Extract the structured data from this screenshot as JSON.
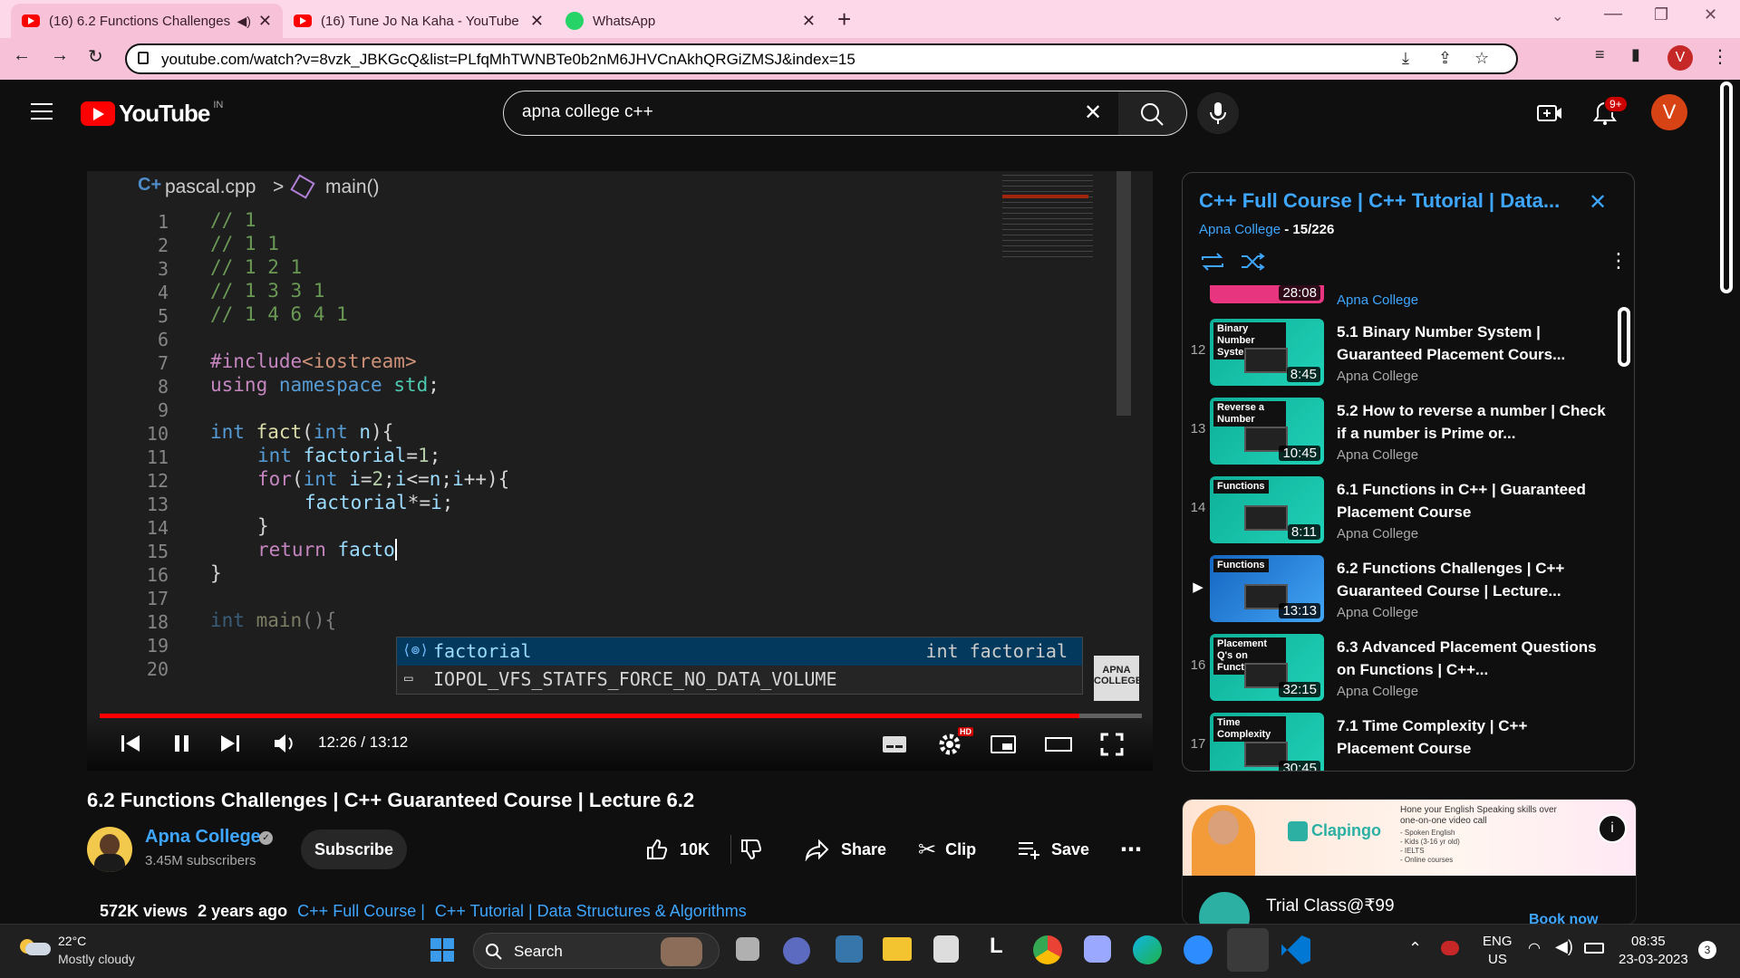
{
  "browser": {
    "tabs": [
      {
        "title": "(16) 6.2 Functions Challenges",
        "icon": "youtube-icon",
        "active": true
      },
      {
        "title": "(16) Tune Jo Na Kaha - YouTube",
        "icon": "youtube-icon",
        "active": false
      },
      {
        "title": "WhatsApp",
        "icon": "whatsapp-icon",
        "active": false
      }
    ],
    "url": "youtube.com/watch?v=8vzk_JBKGcQ&list=PLfqMhTWNBTe0b2nM6JHVCnAkhQRGiZMSJ&index=15",
    "profile_initial": "V"
  },
  "youtube": {
    "logo_text": "YouTube",
    "region": "IN",
    "search_value": "apna college c++",
    "notifications_badge": "9+",
    "avatar_initial": "V"
  },
  "editor": {
    "breadcrumb_file": "pascal.cpp",
    "breadcrumb_symbol": "main()",
    "line_numbers": [
      "1",
      "2",
      "3",
      "4",
      "5",
      "6",
      "7",
      "8",
      "9",
      "10",
      "11",
      "12",
      "13",
      "14",
      "15",
      "16",
      "17",
      "18",
      "19",
      "20"
    ],
    "suggestions": [
      {
        "text": "factorial",
        "detail": "int factorial"
      },
      {
        "text": "IOPOL_VFS_STATFS_FORCE_NO_DATA_VOLUME",
        "detail": ""
      }
    ],
    "watermark": "APNA COLLEGE"
  },
  "player": {
    "time_current": "12:26",
    "time_total": "13:12",
    "time_display": "12:26 / 13:12",
    "progress_fraction": 0.94,
    "hd_badge": "HD"
  },
  "video": {
    "title": "6.2 Functions Challenges | C++ Guaranteed Course | Lecture 6.2",
    "channel": "Apna College",
    "subscribers": "3.45M subscribers",
    "subscribe_label": "Subscribe",
    "likes": "10K",
    "share_label": "Share",
    "clip_label": "Clip",
    "save_label": "Save",
    "views": "572K views",
    "age": "2 years ago",
    "desc_link1": "C++ Full Course |",
    "desc_link2": "C++ Tutorial | Data Structures & Algorithms"
  },
  "playlist": {
    "title": "C++ Full Course |  C++ Tutorial | Data...",
    "channel": "Apna College",
    "position": " - 15/226",
    "top_partial": {
      "duration": "28:08",
      "channel": "Apna College"
    },
    "items": [
      {
        "num": "12",
        "thumb_label": "Binary Number System",
        "duration": "8:45",
        "title": "5.1 Binary Number System | Guaranteed Placement Cours...",
        "channel": "Apna College",
        "playing": false
      },
      {
        "num": "13",
        "thumb_label": "Reverse a Number",
        "duration": "10:45",
        "title": "5.2 How to reverse a number | Check if a number is Prime or...",
        "channel": "Apna College",
        "playing": false
      },
      {
        "num": "14",
        "thumb_label": "Functions",
        "duration": "8:11",
        "title": "6.1 Functions in C++ | Guaranteed Placement Course",
        "channel": "Apna College",
        "playing": false
      },
      {
        "num": "",
        "thumb_label": "Functions",
        "duration": "13:13",
        "title": "6.2 Functions Challenges | C++ Guaranteed Course | Lecture...",
        "channel": "Apna College",
        "playing": true
      },
      {
        "num": "16",
        "thumb_label": "Placement Q's on Functions",
        "duration": "32:15",
        "title": "6.3 Advanced Placement Questions on Functions | C++...",
        "channel": "Apna College",
        "playing": false
      },
      {
        "num": "17",
        "thumb_label": "Time Complexity",
        "duration": "30:45",
        "title": "7.1 Time Complexity | C++ Placement Course",
        "channel": "",
        "playing": false
      }
    ]
  },
  "ad": {
    "brand": "Clapingo",
    "headline": "Hone your English Speaking skills over one-on-one video call",
    "bullets": [
      "- Spoken English",
      "- Kids (3-16 yr old)",
      "- IELTS",
      "- Online courses"
    ],
    "cta_title": "Trial Class@₹99",
    "cta_button": "Book now"
  },
  "taskbar": {
    "temperature": "22°C",
    "weather": "Mostly cloudy",
    "search_label": "Search",
    "lang1": "ENG",
    "lang2": "US",
    "time": "08:35",
    "date": "23-03-2023",
    "notif_count": "3"
  },
  "colors": {
    "tab_bar": "#fdd8e8",
    "youtube_red": "#ff0000",
    "link_blue": "#3ea6ff",
    "playlist_title": "#3ea6ff"
  }
}
